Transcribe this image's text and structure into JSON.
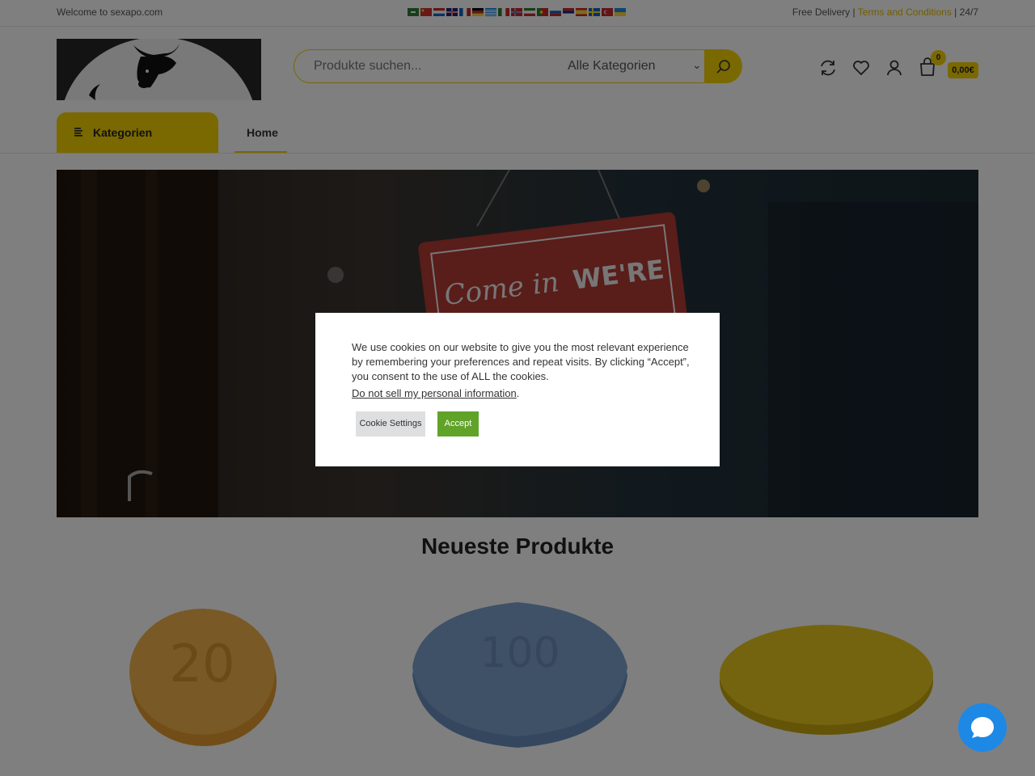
{
  "topbar": {
    "welcome": "Welcome to sexapo.com",
    "free_delivery": "Free Delivery |",
    "terms": "Terms and Conditions",
    "sep": "|",
    "hours": "24/7",
    "flags": [
      "ar",
      "zh-CN",
      "nl",
      "en",
      "fr",
      "de",
      "el",
      "it",
      "no",
      "fa",
      "pt",
      "ru",
      "sr",
      "es",
      "sv",
      "tr",
      "uk"
    ]
  },
  "search": {
    "placeholder": "Produkte suchen...",
    "category": "Alle Kategorien"
  },
  "header": {
    "cart_count": "0",
    "cart_total": "0,00€"
  },
  "nav": {
    "categories_label": "Kategorien",
    "home_label": "Home"
  },
  "hero": {
    "sign_text_1": "Come in",
    "sign_text_2": "WE'RE"
  },
  "section": {
    "title": "Neueste Produkte"
  },
  "products": [
    {
      "pill_label": "20",
      "color": "#f2b24a"
    },
    {
      "pill_label": "100",
      "color": "#7fa3cf"
    },
    {
      "pill_label": "",
      "color": "#e8c91f"
    }
  ],
  "cookie": {
    "text": "We use cookies on our website to give you the most relevant experience by remembering your preferences and repeat visits. By clicking “Accept”, you consent to the use of ALL the cookies.",
    "privacy_link": "Do not sell my personal information",
    "privacy_suffix": ".",
    "settings_label": "Cookie Settings",
    "accept_label": "Accept"
  },
  "colors": {
    "accent": "#f4d000",
    "accept": "#61a229",
    "chat": "#1e88e5"
  }
}
